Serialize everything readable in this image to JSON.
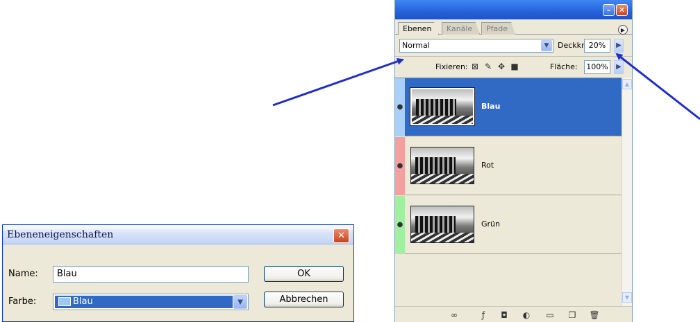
{
  "layers_panel": {
    "tabs": [
      "Ebenen",
      "Kanäle",
      "Pfade"
    ],
    "blend_mode": "Normal",
    "opacity_label": "Deckkr.:",
    "opacity_value": "20%",
    "lock_label": "Fixieren:",
    "fill_label": "Fläche:",
    "fill_value": "100%",
    "layers": [
      {
        "name": "Blau",
        "color": "#a8d0f8",
        "selected": true
      },
      {
        "name": "Rot",
        "color": "#f4a0a0",
        "selected": false
      },
      {
        "name": "Grün",
        "color": "#a0f0a0",
        "selected": false
      }
    ]
  },
  "dialog": {
    "title": "Ebeneneigenschaften",
    "name_label": "Name:",
    "name_value": "Blau",
    "color_label": "Farbe:",
    "color_value": "Blau",
    "ok_label": "OK",
    "cancel_label": "Abbrechen"
  },
  "colors": {
    "selection": "#316ac5",
    "arrow": "#1f2ccf",
    "blue_chip": "#9cc8f5"
  }
}
